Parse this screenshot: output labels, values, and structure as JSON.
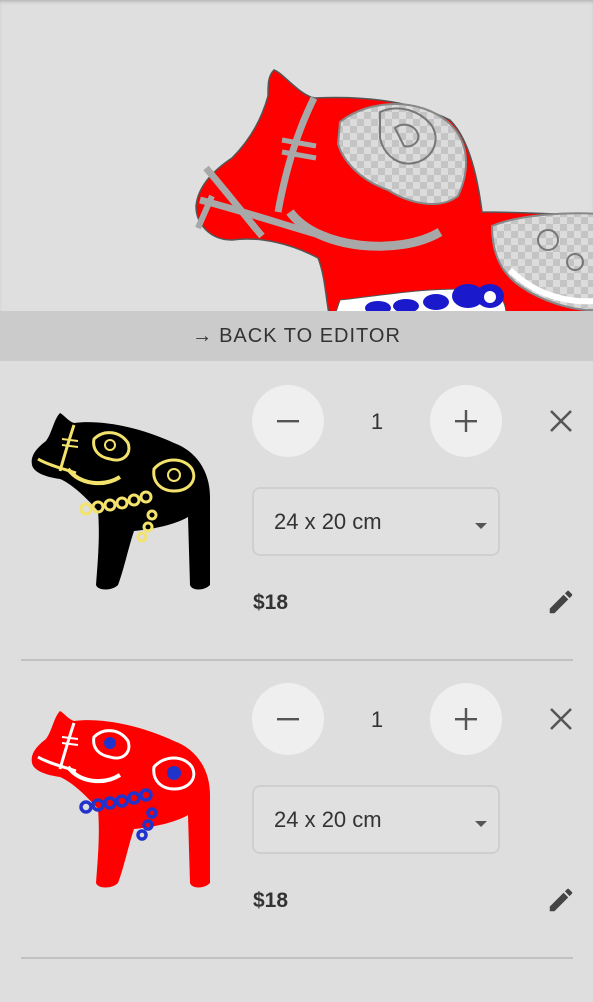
{
  "nav": {
    "back_arrow": "→",
    "back_label": "BACK TO EDITOR"
  },
  "preview": {
    "horse_color": "#ff0000",
    "pattern_color": "#a8a8a8",
    "accent_color": "#1a1acc"
  },
  "cart": {
    "items": [
      {
        "quantity": "1",
        "size": "24 x 20 cm",
        "price": "$18",
        "horse_color": "#000000",
        "pattern_color": "#f3e26b",
        "accent_color": "#f3e26b"
      },
      {
        "quantity": "1",
        "size": "24 x 20 cm",
        "price": "$18",
        "horse_color": "#ff0000",
        "pattern_color": "#ffffff",
        "accent_color": "#2233cc"
      }
    ]
  },
  "icons": {
    "minus": "minus-icon",
    "plus": "plus-icon",
    "close": "close-icon",
    "edit": "pencil-icon",
    "dropdown": "caret-down-icon"
  }
}
